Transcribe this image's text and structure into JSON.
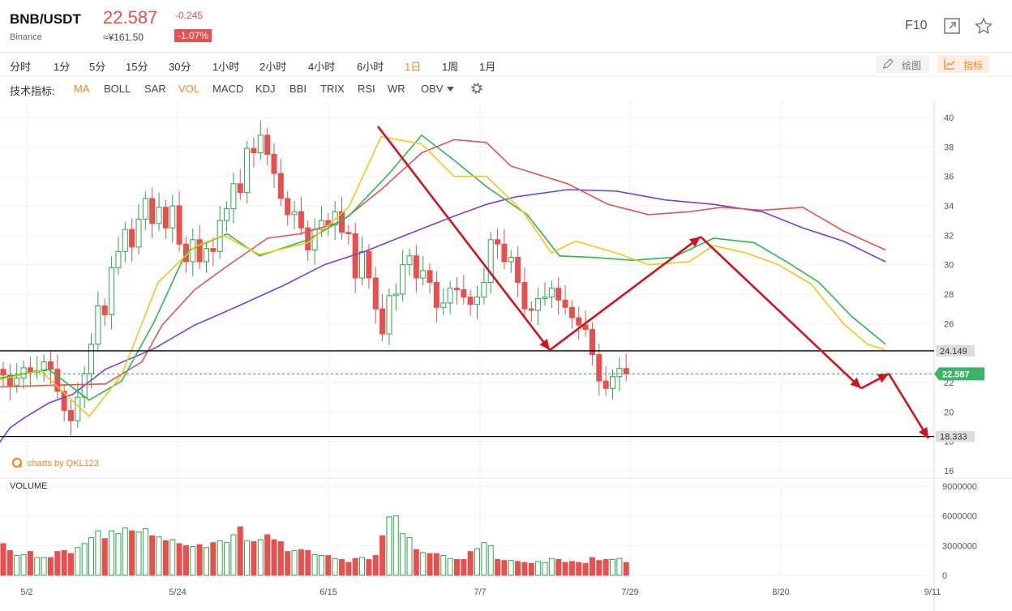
{
  "header": {
    "pair": "BNB/USDT",
    "exchange": "Binance",
    "price": "22.587",
    "change": "-0.245",
    "change_pct": "-1.07%",
    "price_cny": "≈¥161.50",
    "f10": "F10",
    "icons": [
      "expand-icon",
      "star-icon"
    ]
  },
  "timeframes": {
    "items": [
      "分时",
      "1分",
      "5分",
      "15分",
      "30分",
      "1小时",
      "2小时",
      "4小时",
      "6小时",
      "1日",
      "1周",
      "1月"
    ],
    "active": "1日",
    "draw_label": "绘图",
    "indicator_label": "指标"
  },
  "indicators": {
    "label": "技术指标:",
    "items": [
      "MA",
      "BOLL",
      "SAR",
      "VOL",
      "MACD",
      "KDJ",
      "BBI",
      "TRIX",
      "RSI",
      "WR",
      "OBV"
    ],
    "active": [
      "MA",
      "VOL"
    ]
  },
  "watermark": "charts by QKL123",
  "volume_label": "VOLUME",
  "colors": {
    "up": "#2aa84a",
    "down": "#e84f4f",
    "ma5": "#f5c518",
    "ma10": "#2db84d",
    "ma30": "#e05555",
    "ma60": "#7b3fd1",
    "arrow": "#d0141d",
    "accent": "#f08a24"
  },
  "chart_data": {
    "type": "candlestick",
    "x_ticks": [
      "5/2",
      "5/24",
      "6/15",
      "7/7",
      "7/29",
      "8/20",
      "9/11"
    ],
    "price_ticks": [
      "40",
      "38",
      "36",
      "34",
      "32",
      "30",
      "28",
      "26",
      "24",
      "22",
      "20",
      "18",
      "16"
    ],
    "volume_ticks": [
      "9000000",
      "6000000",
      "3000000",
      "0"
    ],
    "ylim": [
      16,
      40
    ],
    "volume_lim": [
      0,
      9000000
    ],
    "last_price": "22.587",
    "support_levels": [
      "24.149",
      "18.333"
    ],
    "close": [
      22.5,
      21.8,
      22.3,
      23.0,
      22.7,
      22.8,
      23.4,
      22.9,
      21.4,
      20.1,
      19.4,
      21.0,
      22.6,
      24.6,
      27.2,
      26.6,
      29.8,
      30.9,
      32.4,
      31.2,
      33.1,
      34.5,
      32.8,
      33.9,
      32.5,
      34.0,
      31.4,
      30.2,
      31.7,
      30.2,
      31.1,
      30.9,
      33.0,
      33.8,
      35.5,
      34.9,
      37.9,
      37.6,
      38.8,
      37.5,
      36.2,
      34.5,
      33.4,
      33.6,
      32.5,
      31.0,
      32.4,
      33.0,
      32.7,
      33.6,
      32.2,
      32.1,
      29.1,
      30.9,
      29.1,
      27.0,
      25.3,
      27.9,
      28.0,
      30.0,
      30.6,
      29.1,
      29.6,
      28.8,
      27.1,
      27.4,
      28.4,
      28.3,
      27.8,
      27.3,
      27.8,
      28.8,
      31.7,
      31.4,
      30.2,
      30.5,
      28.8,
      27.0,
      26.9,
      27.7,
      27.8,
      28.4,
      27.6,
      27.1,
      26.4,
      25.9,
      25.6,
      23.9,
      22.1,
      21.6,
      22.4,
      22.95,
      22.587
    ],
    "volume": [
      3200000,
      2500000,
      2000000,
      2100000,
      2400000,
      1800000,
      1800000,
      1800000,
      2400000,
      2500000,
      2200000,
      2800000,
      3200000,
      3800000,
      4500000,
      3700000,
      4500000,
      4200000,
      4800000,
      4500000,
      4400000,
      4700000,
      4000000,
      3900000,
      3500000,
      3600000,
      3200000,
      3000000,
      2900000,
      3100000,
      2800000,
      3300000,
      3500000,
      3300000,
      4100000,
      4900000,
      3500000,
      3400000,
      3600000,
      4100000,
      3600000,
      3400000,
      2400000,
      2500000,
      2600000,
      2500000,
      2100000,
      2000000,
      2000000,
      1700000,
      1600000,
      1300000,
      1700000,
      1800000,
      1600000,
      2000000,
      4000000,
      5900000,
      6000000,
      4200000,
      3800000,
      2600000,
      2300000,
      2200000,
      2200000,
      2000000,
      1700000,
      1600000,
      1600000,
      2400000,
      2700000,
      3300000,
      3000000,
      1600000,
      1500000,
      1500000,
      1400000,
      1300000,
      1200000,
      1400000,
      1300000,
      1700000,
      1600000,
      1300000,
      1400000,
      1300000,
      1200000,
      1800000,
      1500000,
      1600000,
      1600000,
      1700000,
      1300000
    ],
    "ma60": [
      [
        -2,
        17.8
      ],
      [
        12,
        18.9
      ],
      [
        30,
        19.6
      ],
      [
        60,
        20.6
      ],
      [
        90,
        21.2
      ],
      [
        130,
        22.9
      ],
      [
        190,
        24.3
      ],
      [
        240,
        25.9
      ],
      [
        290,
        27.1
      ],
      [
        350,
        28.6
      ],
      [
        400,
        30.0
      ],
      [
        450,
        30.9
      ],
      [
        500,
        32.0
      ],
      [
        560,
        33.3
      ],
      [
        600,
        34.1
      ],
      [
        635,
        34.6
      ],
      [
        700,
        35.1
      ],
      [
        760,
        35.0
      ],
      [
        820,
        34.4
      ],
      [
        880,
        34.1
      ],
      [
        940,
        33.6
      ],
      [
        990,
        32.5
      ],
      [
        1040,
        31.6
      ],
      [
        1092,
        30.2
      ]
    ],
    "ma30": [
      [
        0,
        21.7
      ],
      [
        60,
        21.8
      ],
      [
        130,
        21.9
      ],
      [
        175,
        23.4
      ],
      [
        200,
        25.9
      ],
      [
        240,
        28.3
      ],
      [
        280,
        29.9
      ],
      [
        330,
        31.8
      ],
      [
        370,
        32.1
      ],
      [
        420,
        32.9
      ],
      [
        470,
        35.1
      ],
      [
        520,
        37.6
      ],
      [
        560,
        38.5
      ],
      [
        600,
        38.3
      ],
      [
        630,
        36.7
      ],
      [
        700,
        35.5
      ],
      [
        750,
        34.1
      ],
      [
        800,
        33.4
      ],
      [
        850,
        33.6
      ],
      [
        890,
        33.9
      ],
      [
        940,
        33.7
      ],
      [
        990,
        33.9
      ],
      [
        1040,
        32.3
      ],
      [
        1092,
        31.0
      ]
    ],
    "ma10": [
      [
        0,
        22.3
      ],
      [
        60,
        22.9
      ],
      [
        110,
        20.8
      ],
      [
        150,
        22.1
      ],
      [
        190,
        26.1
      ],
      [
        230,
        30.9
      ],
      [
        280,
        32.1
      ],
      [
        320,
        30.6
      ],
      [
        380,
        31.7
      ],
      [
        430,
        33.3
      ],
      [
        480,
        36.2
      ],
      [
        520,
        38.8
      ],
      [
        560,
        37.1
      ],
      [
        600,
        35.3
      ],
      [
        650,
        33.4
      ],
      [
        690,
        30.6
      ],
      [
        730,
        30.5
      ],
      [
        780,
        30.3
      ],
      [
        830,
        30.5
      ],
      [
        880,
        31.8
      ],
      [
        930,
        31.5
      ],
      [
        970,
        30.2
      ],
      [
        1010,
        28.8
      ],
      [
        1050,
        26.5
      ],
      [
        1092,
        24.6
      ]
    ],
    "ma5": [
      [
        0,
        22.2
      ],
      [
        50,
        22.8
      ],
      [
        110,
        19.7
      ],
      [
        150,
        22.5
      ],
      [
        195,
        28.8
      ],
      [
        240,
        31.2
      ],
      [
        275,
        32.0
      ],
      [
        320,
        30.7
      ],
      [
        380,
        31.5
      ],
      [
        430,
        33.9
      ],
      [
        470,
        38.7
      ],
      [
        520,
        38.2
      ],
      [
        560,
        36.0
      ],
      [
        600,
        36.0
      ],
      [
        645,
        33.6
      ],
      [
        680,
        30.8
      ],
      [
        710,
        31.6
      ],
      [
        760,
        30.8
      ],
      [
        800,
        30.0
      ],
      [
        850,
        30.2
      ],
      [
        880,
        31.3
      ],
      [
        920,
        30.8
      ],
      [
        960,
        30.0
      ],
      [
        1000,
        28.7
      ],
      [
        1040,
        26.0
      ],
      [
        1070,
        24.6
      ],
      [
        1092,
        24.2
      ]
    ],
    "arrows": [
      [
        [
          466,
          39.4
        ],
        [
          678,
          24.2
        ]
      ],
      [
        [
          678,
          24.2
        ],
        [
          864,
          31.9
        ]
      ],
      [
        [
          864,
          31.9
        ],
        [
          1062,
          21.6
        ]
      ],
      [
        [
          1062,
          21.6
        ],
        [
          1096,
          22.6
        ]
      ],
      [
        [
          1096,
          22.6
        ],
        [
          1145,
          18.2
        ]
      ]
    ]
  }
}
